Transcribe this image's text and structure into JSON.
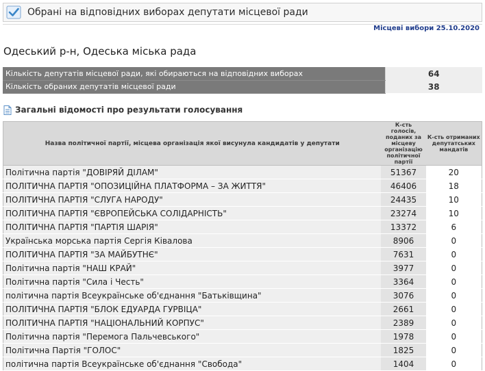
{
  "header": {
    "title": "Обрані на відповідних виборах депутати місцевої ради",
    "election_date": "Місцеві вибори 25.10.2020"
  },
  "council": {
    "name": "Одеський р-н, Одеська міська рада"
  },
  "summary": [
    {
      "label": "Кількість депутатів місцевої ради, які обираються на відповідних виборах",
      "value": "64"
    },
    {
      "label": "Кількість обраних депутатів місцевої ради",
      "value": "38"
    }
  ],
  "section": {
    "title": "Загальні відомості про результати голосування",
    "icon": "document-icon"
  },
  "results": {
    "headers": {
      "party": "Назва політичної партії, місцева організація якої висунула кандидатів у депутати",
      "votes": "К-сть голосів, поданих за місцеву організацію політичної партії",
      "seats": "К-сть отриманих депутатських мандатів"
    },
    "rows": [
      {
        "party": "Політична партія \"ДОВІРЯЙ ДІЛАМ\"",
        "votes": "51367",
        "seats": "20"
      },
      {
        "party": "ПОЛІТИЧНА ПАРТІЯ \"ОПОЗИЦІЙНА ПЛАТФОРМА – ЗА ЖИТТЯ\"",
        "votes": "46406",
        "seats": "18"
      },
      {
        "party": "ПОЛІТИЧНА ПАРТІЯ \"СЛУГА НАРОДУ\"",
        "votes": "24435",
        "seats": "10"
      },
      {
        "party": "ПОЛІТИЧНА ПАРТІЯ \"ЄВРОПЕЙСЬКА СОЛІДАРНІСТЬ\"",
        "votes": "23274",
        "seats": "10"
      },
      {
        "party": "ПОЛІТИЧНА ПАРТІЯ \"ПАРТІЯ ШАРІЯ\"",
        "votes": "13372",
        "seats": "6"
      },
      {
        "party": "Українська морська партія Сергія Ківалова",
        "votes": "8906",
        "seats": "0"
      },
      {
        "party": "ПОЛІТИЧНА ПАРТІЯ \"ЗА МАЙБУТНЄ\"",
        "votes": "7631",
        "seats": "0"
      },
      {
        "party": "Політична партія \"НАШ КРАЙ\"",
        "votes": "3977",
        "seats": "0"
      },
      {
        "party": "Політична партія \"Сила і Честь\"",
        "votes": "3364",
        "seats": "0"
      },
      {
        "party": "політична партія Всеукраїнське об'єднання \"Батьківщина\"",
        "votes": "3076",
        "seats": "0"
      },
      {
        "party": "ПОЛІТИЧНА ПАРТІЯ \"БЛОК ЕДУАРДА ГУРВІЦА\"",
        "votes": "2661",
        "seats": "0"
      },
      {
        "party": "ПОЛІТИЧНА ПАРТІЯ \"НАЦІОНАЛЬНИЙ КОРПУС\"",
        "votes": "2389",
        "seats": "0"
      },
      {
        "party": "Політична партія \"Перемога Пальчевського\"",
        "votes": "1978",
        "seats": "0"
      },
      {
        "party": "Політична Партія \"ГОЛОС\"",
        "votes": "1825",
        "seats": "0"
      },
      {
        "party": "політична партія Всеукраїнське об'єднання \"Свобода\"",
        "votes": "1404",
        "seats": "0"
      }
    ]
  },
  "colors": {
    "summary_label_bg": "#7a7a7a",
    "header_bg": "#d9d9d9",
    "party_cell_bg": "#efefef",
    "votes_cell_bg": "#e3e3e3",
    "date_text": "#1f3c8c",
    "checkbox_accent": "#3a86c8"
  }
}
